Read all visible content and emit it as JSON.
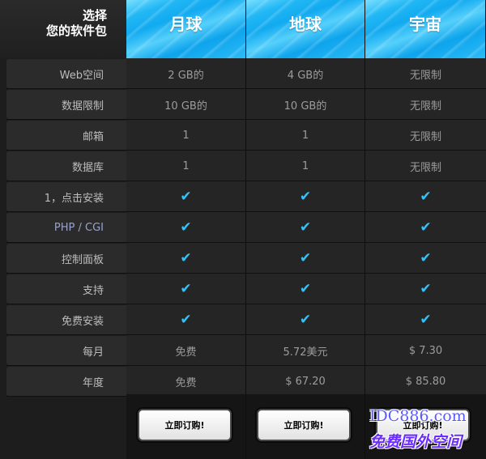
{
  "corner": {
    "line1": "选择",
    "line2": "您的软件包"
  },
  "plans": [
    {
      "name": "月球",
      "order": "立即订购!"
    },
    {
      "name": "地球",
      "order": "立即订购!"
    },
    {
      "name": "宇宙",
      "order": "立即订购!"
    }
  ],
  "rows": [
    {
      "label": "Web空间",
      "values": [
        "2 GB的",
        "4 GB的",
        "无限制"
      ]
    },
    {
      "label": "数据限制",
      "values": [
        "10 GB的",
        "10 GB的",
        "无限制"
      ]
    },
    {
      "label": "邮箱",
      "values": [
        "1",
        "1",
        "无限制"
      ]
    },
    {
      "label": "数据库",
      "values": [
        "1",
        "1",
        "无限制"
      ]
    },
    {
      "label": "1，点击安装",
      "values": [
        "✔",
        "✔",
        "✔"
      ]
    },
    {
      "label": "PHP / CGI",
      "values": [
        "✔",
        "✔",
        "✔"
      ]
    },
    {
      "label": "控制面板",
      "values": [
        "✔",
        "✔",
        "✔"
      ]
    },
    {
      "label": "支持",
      "values": [
        "✔",
        "✔",
        "✔"
      ]
    },
    {
      "label": "免费安装",
      "values": [
        "✔",
        "✔",
        "✔"
      ]
    },
    {
      "label": "每月",
      "values": [
        "免费",
        "5.72美元",
        "$ 7.30"
      ]
    },
    {
      "label": "年度",
      "values": [
        "免费",
        "$ 67.20",
        "$ 85.80"
      ]
    }
  ],
  "watermark": {
    "line1": "IDC886.com",
    "line2": "免费国外空间"
  },
  "colors": {
    "accent": "#12aaf0",
    "check": "#2ec5ff"
  }
}
